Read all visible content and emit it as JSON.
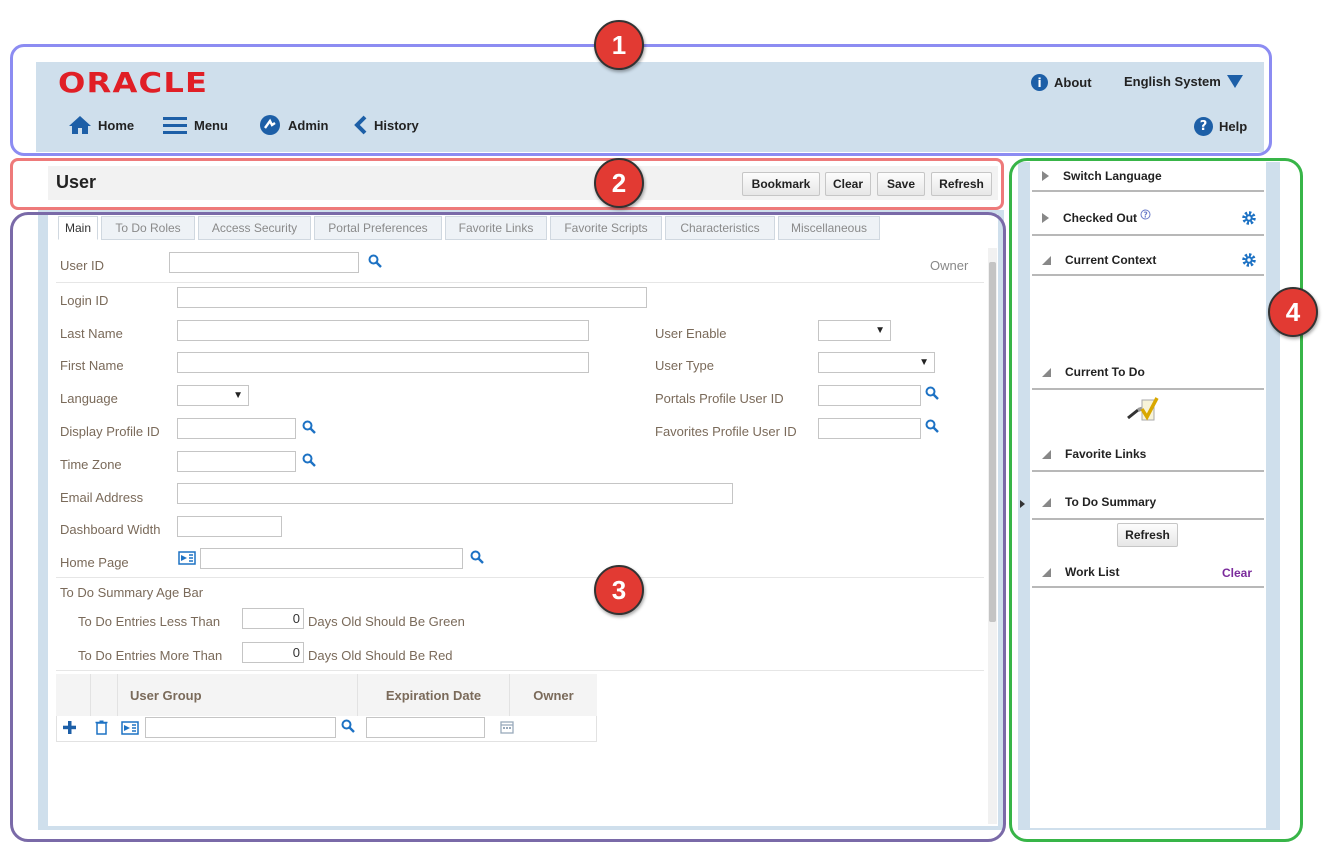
{
  "header": {
    "logo": "ORACLE",
    "nav": [
      {
        "label": "Home",
        "icon": "home-icon"
      },
      {
        "label": "Menu",
        "icon": "menu-icon"
      },
      {
        "label": "Admin",
        "icon": "admin-icon"
      },
      {
        "label": "History",
        "icon": "history-icon"
      }
    ],
    "about_label": "About",
    "language_label": "English System",
    "help_label": "Help"
  },
  "titlebar": {
    "title": "User",
    "buttons": [
      "Bookmark",
      "Clear",
      "Save",
      "Refresh"
    ]
  },
  "tabs": [
    "Main",
    "To Do Roles",
    "Access Security",
    "Portal Preferences",
    "Favorite Links",
    "Favorite Scripts",
    "Characteristics",
    "Miscellaneous"
  ],
  "form": {
    "user_id_label": "User ID",
    "owner_label": "Owner",
    "login_id_label": "Login ID",
    "last_name_label": "Last Name",
    "first_name_label": "First Name",
    "language_label": "Language",
    "display_profile_label": "Display Profile ID",
    "time_zone_label": "Time Zone",
    "email_label": "Email Address",
    "dashboard_width_label": "Dashboard Width",
    "home_page_label": "Home Page",
    "user_enable_label": "User Enable",
    "user_type_label": "User Type",
    "portals_profile_label": "Portals Profile User ID",
    "favorites_profile_label": "Favorites Profile User ID",
    "age_bar_title": "To Do Summary Age Bar",
    "less_than_label": "To Do Entries Less Than",
    "less_than_value": "0",
    "green_suffix": "Days Old Should Be Green",
    "more_than_label": "To Do Entries More Than",
    "more_than_value": "0",
    "red_suffix": "Days Old Should Be Red"
  },
  "grid": {
    "headers": [
      "User Group",
      "Expiration Date",
      "Owner"
    ]
  },
  "dashboard": {
    "sections": {
      "switch_language": "Switch Language",
      "checked_out": "Checked Out",
      "current_context": "Current Context",
      "current_todo": "Current To Do",
      "favorite_links": "Favorite Links",
      "todo_summary": "To Do Summary",
      "work_list": "Work List"
    },
    "refresh_label": "Refresh",
    "clear_label": "Clear"
  },
  "annotations": [
    "1",
    "2",
    "3",
    "4"
  ],
  "colors": {
    "frame1": "#8c8cf2",
    "frame2": "#ee7a7a",
    "frame3": "#7a6aa8",
    "frame4": "#38b548",
    "badge": "#e23a33",
    "accent": "#1d5fa7",
    "oracle_red": "#e01f26"
  }
}
